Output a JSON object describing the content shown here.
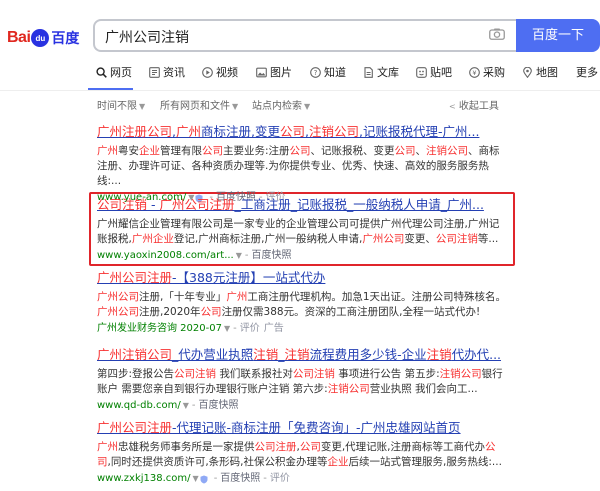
{
  "header": {
    "logo_text_1": "Bai",
    "logo_paw": "du",
    "logo_text_2": "百度",
    "query": "广州公司注销",
    "search_button": "百度一下"
  },
  "tabs": [
    {
      "label": "网页",
      "icon": "search-icon"
    },
    {
      "label": "资讯",
      "icon": "news-icon"
    },
    {
      "label": "视频",
      "icon": "video-icon"
    },
    {
      "label": "图片",
      "icon": "image-icon"
    },
    {
      "label": "知道",
      "icon": "question-icon"
    },
    {
      "label": "文库",
      "icon": "doc-icon"
    },
    {
      "label": "贴吧",
      "icon": "tieba-icon"
    },
    {
      "label": "采购",
      "icon": "purchase-icon"
    },
    {
      "label": "地图",
      "icon": "map-icon"
    },
    {
      "label": "更多",
      "icon": ""
    }
  ],
  "filters": {
    "time": "时间不限",
    "files": "所有网页和文件",
    "site": "站点内检索",
    "collapse": "收起工具"
  },
  "results": [
    {
      "title_parts": [
        {
          "t": "广州注册公司",
          "hl": true
        },
        {
          "t": ",",
          "hl": false
        },
        {
          "t": "广州",
          "hl": true
        },
        {
          "t": "商标注册,变更",
          "hl": false
        },
        {
          "t": "公司",
          "hl": true
        },
        {
          "t": ",",
          "hl": false
        },
        {
          "t": "注销公司",
          "hl": true
        },
        {
          "t": ",记账报税代理-广州...",
          "hl": false
        }
      ],
      "desc_parts": [
        {
          "t": "广州",
          "hl": true
        },
        {
          "t": "粤安",
          "hl": false
        },
        {
          "t": "企业",
          "hl": true
        },
        {
          "t": "管理有限",
          "hl": false
        },
        {
          "t": "公司",
          "hl": true
        },
        {
          "t": "主要业务:注册",
          "hl": false
        },
        {
          "t": "公司",
          "hl": true
        },
        {
          "t": "、记账报税、变更",
          "hl": false
        },
        {
          "t": "公司",
          "hl": true
        },
        {
          "t": "、",
          "hl": false
        },
        {
          "t": "注销公司",
          "hl": true
        },
        {
          "t": "、商标注册、办理许可证、各种资质办理等.为你提供专业、优秀、快速、高效的服务服务热线:...",
          "hl": false
        }
      ],
      "url": "www.yue-an.com/",
      "snapshot": "百度快照",
      "eval": "评价",
      "ad": ""
    },
    {
      "title_parts": [
        {
          "t": "公司注销",
          "hl": true
        },
        {
          "t": " - ",
          "hl": false
        },
        {
          "t": "广州公司注册",
          "hl": true
        },
        {
          "t": "_工商注册_记账报税_一般纳税人申请_广州...",
          "hl": false
        }
      ],
      "desc_parts": [
        {
          "t": "广州耀信企业管理有限公司是一家专业的企业管理公司可提供广州代理公司注册,广州记账报税,",
          "hl": false
        },
        {
          "t": "广州企业",
          "hl": true
        },
        {
          "t": "登记,广州商标注册,广州一般纳税人申请,",
          "hl": false
        },
        {
          "t": "广州公司",
          "hl": true
        },
        {
          "t": "变更、",
          "hl": false
        },
        {
          "t": "公司注销",
          "hl": true
        },
        {
          "t": "等...",
          "hl": false
        }
      ],
      "url": "www.yaoxin2008.com/art...",
      "snapshot": "百度快照",
      "eval": "",
      "ad": ""
    },
    {
      "title_parts": [
        {
          "t": "广州公司注册",
          "hl": true
        },
        {
          "t": "-【388元注册】一站式代办",
          "hl": false
        }
      ],
      "desc_parts": [
        {
          "t": "广州公司",
          "hl": true
        },
        {
          "t": "注册,「十年专业」",
          "hl": false
        },
        {
          "t": "广州",
          "hl": true
        },
        {
          "t": "工商注册代理机构。加急1天出证。注册公司特殊核名。",
          "hl": false
        },
        {
          "t": "广州公司",
          "hl": true
        },
        {
          "t": "注册,2020年",
          "hl": false
        },
        {
          "t": "公司",
          "hl": true
        },
        {
          "t": "注册仅需388元。资深的工商注册团队,全程一站式代办!",
          "hl": false
        }
      ],
      "url": "广州发业财务咨询 2020-07",
      "snapshot": "",
      "eval": "评价",
      "ad": "广告"
    },
    {
      "title_parts": [
        {
          "t": "广州注销公司",
          "hl": true
        },
        {
          "t": "_代办营业执照",
          "hl": false
        },
        {
          "t": "注销",
          "hl": true
        },
        {
          "t": "_",
          "hl": false
        },
        {
          "t": "注销",
          "hl": true
        },
        {
          "t": "流程费用多少钱-企业",
          "hl": false
        },
        {
          "t": "注销",
          "hl": true
        },
        {
          "t": "代办代...",
          "hl": false
        }
      ],
      "desc_parts": [
        {
          "t": "第四步:登报公告",
          "hl": false
        },
        {
          "t": "公司注销",
          "hl": true
        },
        {
          "t": " 我们联系报社对",
          "hl": false
        },
        {
          "t": "公司注销",
          "hl": true
        },
        {
          "t": " 事项进行公告 第五步:",
          "hl": false
        },
        {
          "t": "注销公司",
          "hl": true
        },
        {
          "t": "银行账户 需要您亲自到银行办理银行账户注销 第六步:",
          "hl": false
        },
        {
          "t": "注销公司",
          "hl": true
        },
        {
          "t": "营业执照 我们会向工...",
          "hl": false
        }
      ],
      "url": "www.qd-db.com/",
      "snapshot": "百度快照",
      "eval": "",
      "ad": ""
    },
    {
      "title_parts": [
        {
          "t": "广州公司注册",
          "hl": true
        },
        {
          "t": "-代理记账-商标注册「免费咨询」-广州忠雄网站首页",
          "hl": false
        }
      ],
      "desc_parts": [
        {
          "t": "广州",
          "hl": true
        },
        {
          "t": "忠雄税务师事务所是一家提供",
          "hl": false
        },
        {
          "t": "公司注册",
          "hl": true
        },
        {
          "t": ",",
          "hl": false
        },
        {
          "t": "公司",
          "hl": true
        },
        {
          "t": "变更,代理记账,注册商标等工商代办",
          "hl": false
        },
        {
          "t": "公司",
          "hl": true
        },
        {
          "t": ",同时还提供资质许可,条形码,社保公积金办理等",
          "hl": false
        },
        {
          "t": "企业",
          "hl": true
        },
        {
          "t": "后续一站式管理服务,服务热线:...",
          "hl": false
        }
      ],
      "url": "www.zxkj138.com/",
      "snapshot": "百度快照",
      "eval": "评价",
      "ad": ""
    }
  ]
}
